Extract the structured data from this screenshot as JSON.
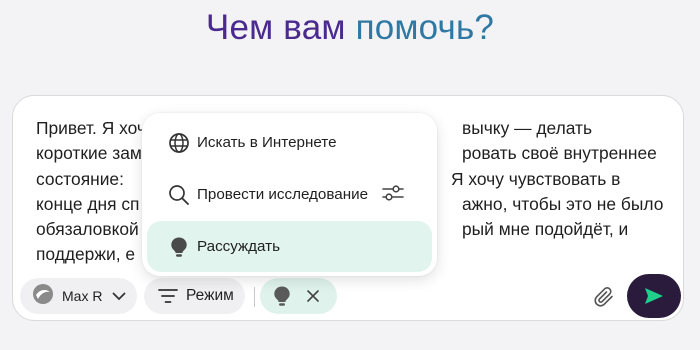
{
  "heading": {
    "part1": "Чем вам ",
    "part2": "помочь?"
  },
  "message": {
    "lines": [
      "Привет. Я хоч",
      "короткие зам",
      "состояние:",
      "конце дня сп",
      "обязаловкой",
      "поддержи, е"
    ],
    "lines_right": [
      "вычку — делать",
      "ровать своё внутреннее",
      "Я хочу  чувствовать в",
      "ажно, чтобы это не было",
      "рый мне подойдёт, и",
      ""
    ]
  },
  "menu": {
    "items": [
      {
        "label": "Искать в Интернете",
        "icon": "globe-icon"
      },
      {
        "label": "Провести исследование",
        "icon": "search-icon"
      },
      {
        "label": "Рассуждать",
        "icon": "lightbulb-icon"
      }
    ]
  },
  "toolbar": {
    "model_label": "Max R",
    "mode_label": "Режим"
  },
  "colors": {
    "heading_left": "#4b2a8f",
    "heading_right": "#2f78a3",
    "active_bg": "#e2f4ee",
    "send_bg": "#2a1a3b",
    "send_arrow": "#1fd08a"
  }
}
